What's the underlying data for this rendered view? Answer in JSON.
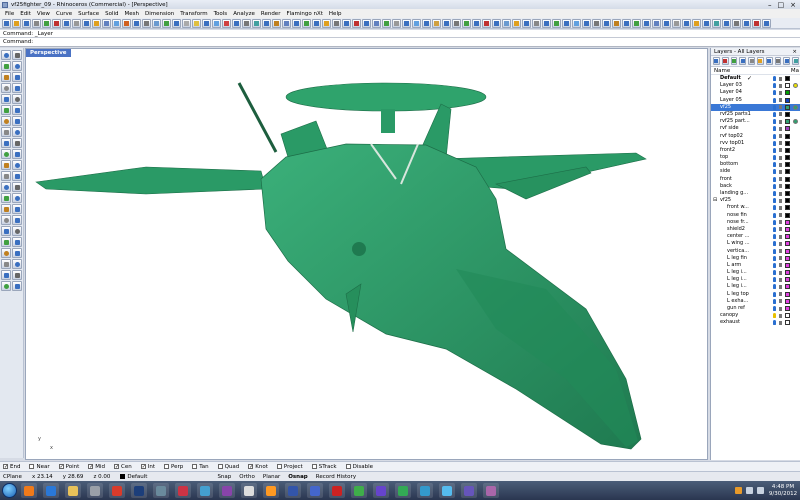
{
  "window": {
    "title": "vf25fighter_09 - Rhinoceros (Commercial) - [Perspective]"
  },
  "menu": [
    "File",
    "Edit",
    "View",
    "Curve",
    "Surface",
    "Solid",
    "Mesh",
    "Dimension",
    "Transform",
    "Tools",
    "Analyze",
    "Render",
    "Flamingo nXt",
    "Help"
  ],
  "command": {
    "history": "Command: _Layer",
    "prompt": "Command:"
  },
  "viewport": {
    "label": "Perspective",
    "axis_y": "y",
    "axis_x": "x",
    "model_color": "#2a9a66"
  },
  "layers_panel": {
    "title": "Layers - All Layers",
    "column_name": "Name",
    "column_m": "Ma",
    "layers": [
      {
        "name": "Default",
        "indent": 0,
        "current": true,
        "check": "✓",
        "color": "#000000",
        "material_dot": ""
      },
      {
        "name": "Layer 03",
        "indent": 0,
        "color": "#ffffff",
        "material_dot": "#e8e000"
      },
      {
        "name": "Layer 04",
        "indent": 0,
        "color": "#00a000",
        "material_dot": ""
      },
      {
        "name": "Layer 05",
        "indent": 0,
        "color": "#1040c0",
        "material_dot": ""
      },
      {
        "name": "vf25",
        "indent": 0,
        "selected": true,
        "color": "#30a070",
        "material_dot": "#30a070"
      },
      {
        "name": "rvf25 parts1",
        "indent": 0,
        "color": "#000000",
        "material_dot": ""
      },
      {
        "name": "rvf25 part...",
        "indent": 0,
        "color": "#30a070",
        "material_dot": "#30a070"
      },
      {
        "name": "rvf side",
        "indent": 0,
        "color": "#a040c0",
        "material_dot": ""
      },
      {
        "name": "rvf top02",
        "indent": 0,
        "color": "#000000",
        "material_dot": ""
      },
      {
        "name": "rvv top01",
        "indent": 0,
        "color": "#000000",
        "material_dot": ""
      },
      {
        "name": "front2",
        "indent": 0,
        "color": "#000000",
        "material_dot": ""
      },
      {
        "name": "top",
        "indent": 0,
        "color": "#000000",
        "material_dot": ""
      },
      {
        "name": "bottom",
        "indent": 0,
        "color": "#000000",
        "material_dot": ""
      },
      {
        "name": "side",
        "indent": 0,
        "color": "#000000",
        "material_dot": ""
      },
      {
        "name": "front",
        "indent": 0,
        "color": "#000000",
        "material_dot": ""
      },
      {
        "name": "back",
        "indent": 0,
        "color": "#000000",
        "material_dot": ""
      },
      {
        "name": "landing g...",
        "indent": 0,
        "color": "#000000",
        "material_dot": ""
      },
      {
        "name": "vf25",
        "indent": 0,
        "expander": "⊟",
        "color": "#000000",
        "material_dot": ""
      },
      {
        "name": "front w...",
        "indent": 1,
        "color": "#000000",
        "material_dot": ""
      },
      {
        "name": "nose fin",
        "indent": 1,
        "color": "#000000",
        "material_dot": ""
      },
      {
        "name": "nose fr...",
        "indent": 1,
        "color": "#e040e0",
        "material_dot": ""
      },
      {
        "name": "shield2",
        "indent": 1,
        "color": "#e040e0",
        "material_dot": ""
      },
      {
        "name": "center ...",
        "indent": 1,
        "color": "#e040e0",
        "material_dot": ""
      },
      {
        "name": "L wing ...",
        "indent": 1,
        "color": "#e040e0",
        "material_dot": ""
      },
      {
        "name": "vertica...",
        "indent": 1,
        "color": "#e040e0",
        "material_dot": ""
      },
      {
        "name": "L leg fin",
        "indent": 1,
        "color": "#e040e0",
        "material_dot": ""
      },
      {
        "name": "L arm",
        "indent": 1,
        "color": "#e040e0",
        "material_dot": ""
      },
      {
        "name": "L leg i...",
        "indent": 1,
        "color": "#e040e0",
        "material_dot": ""
      },
      {
        "name": "L leg i...",
        "indent": 1,
        "color": "#e040e0",
        "material_dot": ""
      },
      {
        "name": "L leg i...",
        "indent": 1,
        "color": "#e040e0",
        "material_dot": ""
      },
      {
        "name": "L leg top",
        "indent": 1,
        "color": "#e040e0",
        "material_dot": ""
      },
      {
        "name": "L exha...",
        "indent": 1,
        "color": "#e040e0",
        "material_dot": ""
      },
      {
        "name": "gun ref",
        "indent": 1,
        "color": "#e040e0",
        "material_dot": ""
      },
      {
        "name": "canopy",
        "indent": 0,
        "color": "#ffffff",
        "material_dot": ""
      },
      {
        "name": "exhaust",
        "indent": 0,
        "color": "#ffffff",
        "material_dot": ""
      }
    ]
  },
  "osnaps": [
    {
      "label": "End",
      "checked": true
    },
    {
      "label": "Near",
      "checked": false
    },
    {
      "label": "Point",
      "checked": true
    },
    {
      "label": "Mid",
      "checked": true
    },
    {
      "label": "Cen",
      "checked": true
    },
    {
      "label": "Int",
      "checked": true
    },
    {
      "label": "Perp",
      "checked": false
    },
    {
      "label": "Tan",
      "checked": false
    },
    {
      "label": "Quad",
      "checked": false
    },
    {
      "label": "Knot",
      "checked": true
    },
    {
      "label": "Project",
      "checked": false
    },
    {
      "label": "STrack",
      "checked": false
    },
    {
      "label": "Disable",
      "checked": false
    }
  ],
  "status": {
    "cplane": "CPlane",
    "x": "x 23.14",
    "y": "y 28.69",
    "z": "z 0.00",
    "layer": "Default",
    "panes": [
      "Snap",
      "Ortho",
      "Planar",
      "Osnap",
      "Record History"
    ]
  },
  "taskbar": {
    "apps": [
      {
        "name": "firefox",
        "color": "#f07a1a"
      },
      {
        "name": "ie",
        "color": "#2a78d8"
      },
      {
        "name": "explorer",
        "color": "#e8c25a"
      },
      {
        "name": "rhino",
        "color": "#9aa0a8"
      },
      {
        "name": "chrome",
        "color": "#d93b2b"
      },
      {
        "name": "photoshop",
        "color": "#1c3e7a"
      },
      {
        "name": "app7",
        "color": "#6a8a9c"
      },
      {
        "name": "app8",
        "color": "#cc3344"
      },
      {
        "name": "app9",
        "color": "#44a0d0"
      },
      {
        "name": "app10",
        "color": "#8844aa"
      },
      {
        "name": "app11",
        "color": "#dddddd"
      },
      {
        "name": "app12",
        "color": "#ff9922"
      },
      {
        "name": "app13",
        "color": "#3355aa"
      },
      {
        "name": "app14",
        "color": "#4466cc"
      },
      {
        "name": "app15",
        "color": "#cc2222"
      },
      {
        "name": "app16",
        "color": "#3fae4a"
      },
      {
        "name": "app17",
        "color": "#6644cc"
      },
      {
        "name": "app18",
        "color": "#33aa55"
      },
      {
        "name": "app19",
        "color": "#3399cc"
      },
      {
        "name": "app20",
        "color": "#55bbee"
      },
      {
        "name": "app21",
        "color": "#6655bb"
      },
      {
        "name": "app22",
        "color": "#aa66aa"
      }
    ],
    "time": "4:48 PM",
    "date": "9/30/2012"
  }
}
